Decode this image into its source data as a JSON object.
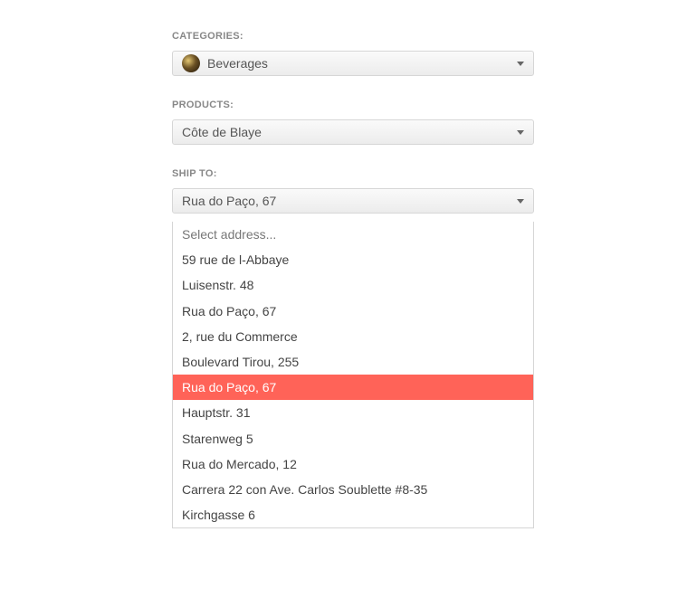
{
  "categories": {
    "label": "CATEGORIES:",
    "selected": "Beverages"
  },
  "products": {
    "label": "PRODUCTS:",
    "selected": "Côte de Blaye"
  },
  "shipTo": {
    "label": "SHIP TO:",
    "selected": "Rua do Paço, 67",
    "placeholder": "Select address...",
    "options": [
      "59 rue de l-Abbaye",
      "Luisenstr. 48",
      "Rua do Paço, 67",
      "2, rue du Commerce",
      "Boulevard Tirou, 255",
      "Rua do Paço, 67",
      "Hauptstr. 31",
      "Starenweg 5",
      "Rua do Mercado, 12",
      "Carrera 22 con Ave. Carlos Soublette #8-35",
      "Kirchgasse 6"
    ],
    "highlightedIndex": 5,
    "colors": {
      "highlight": "#ff6358"
    }
  }
}
